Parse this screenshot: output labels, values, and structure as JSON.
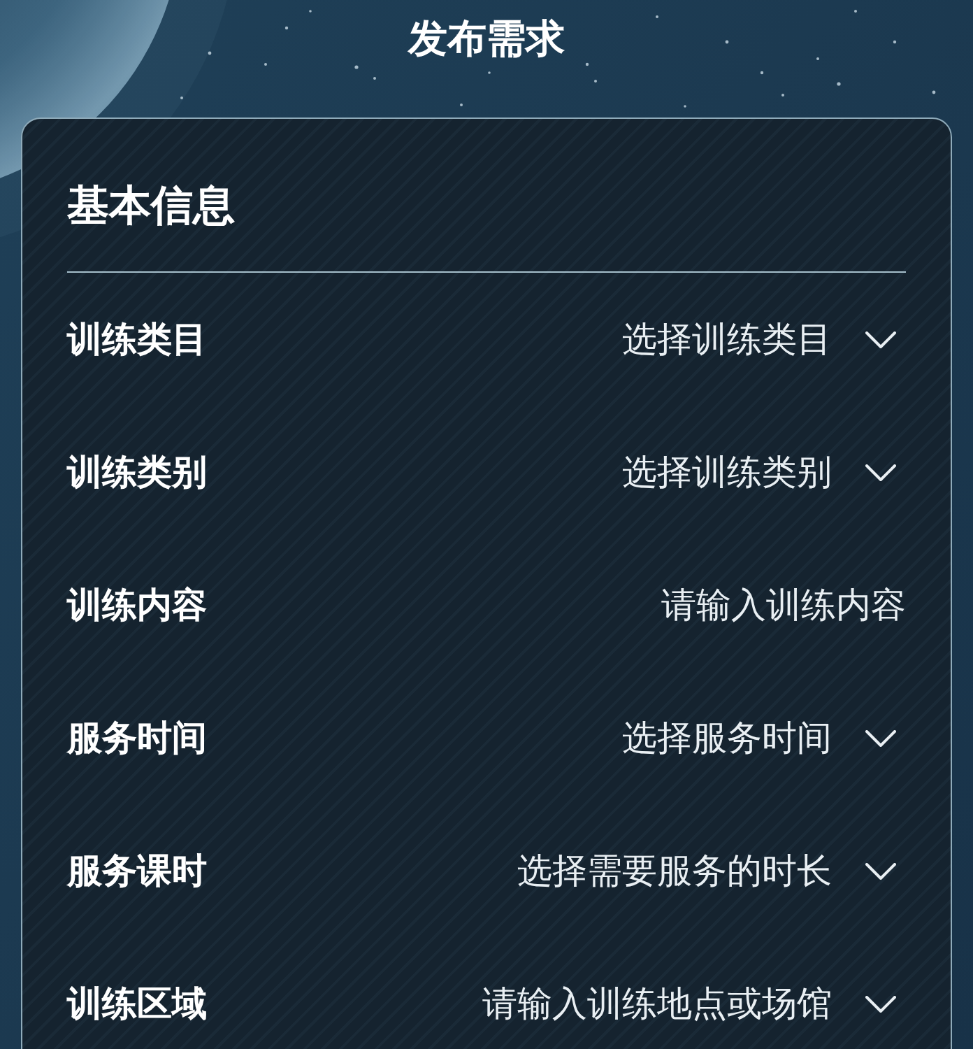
{
  "page": {
    "title": "发布需求"
  },
  "section": {
    "title": "基本信息"
  },
  "fields": [
    {
      "label": "训练类目",
      "kind": "select",
      "placeholder": "选择训练类目"
    },
    {
      "label": "训练类别",
      "kind": "select",
      "placeholder": "选择训练类别"
    },
    {
      "label": "训练内容",
      "kind": "input",
      "placeholder": "请输入训练内容"
    },
    {
      "label": "服务时间",
      "kind": "select",
      "placeholder": "选择服务时间"
    },
    {
      "label": "服务课时",
      "kind": "select",
      "placeholder": "选择需要服务的时长"
    },
    {
      "label": "训练区域",
      "kind": "select",
      "placeholder": "请输入训练地点或场馆"
    }
  ]
}
